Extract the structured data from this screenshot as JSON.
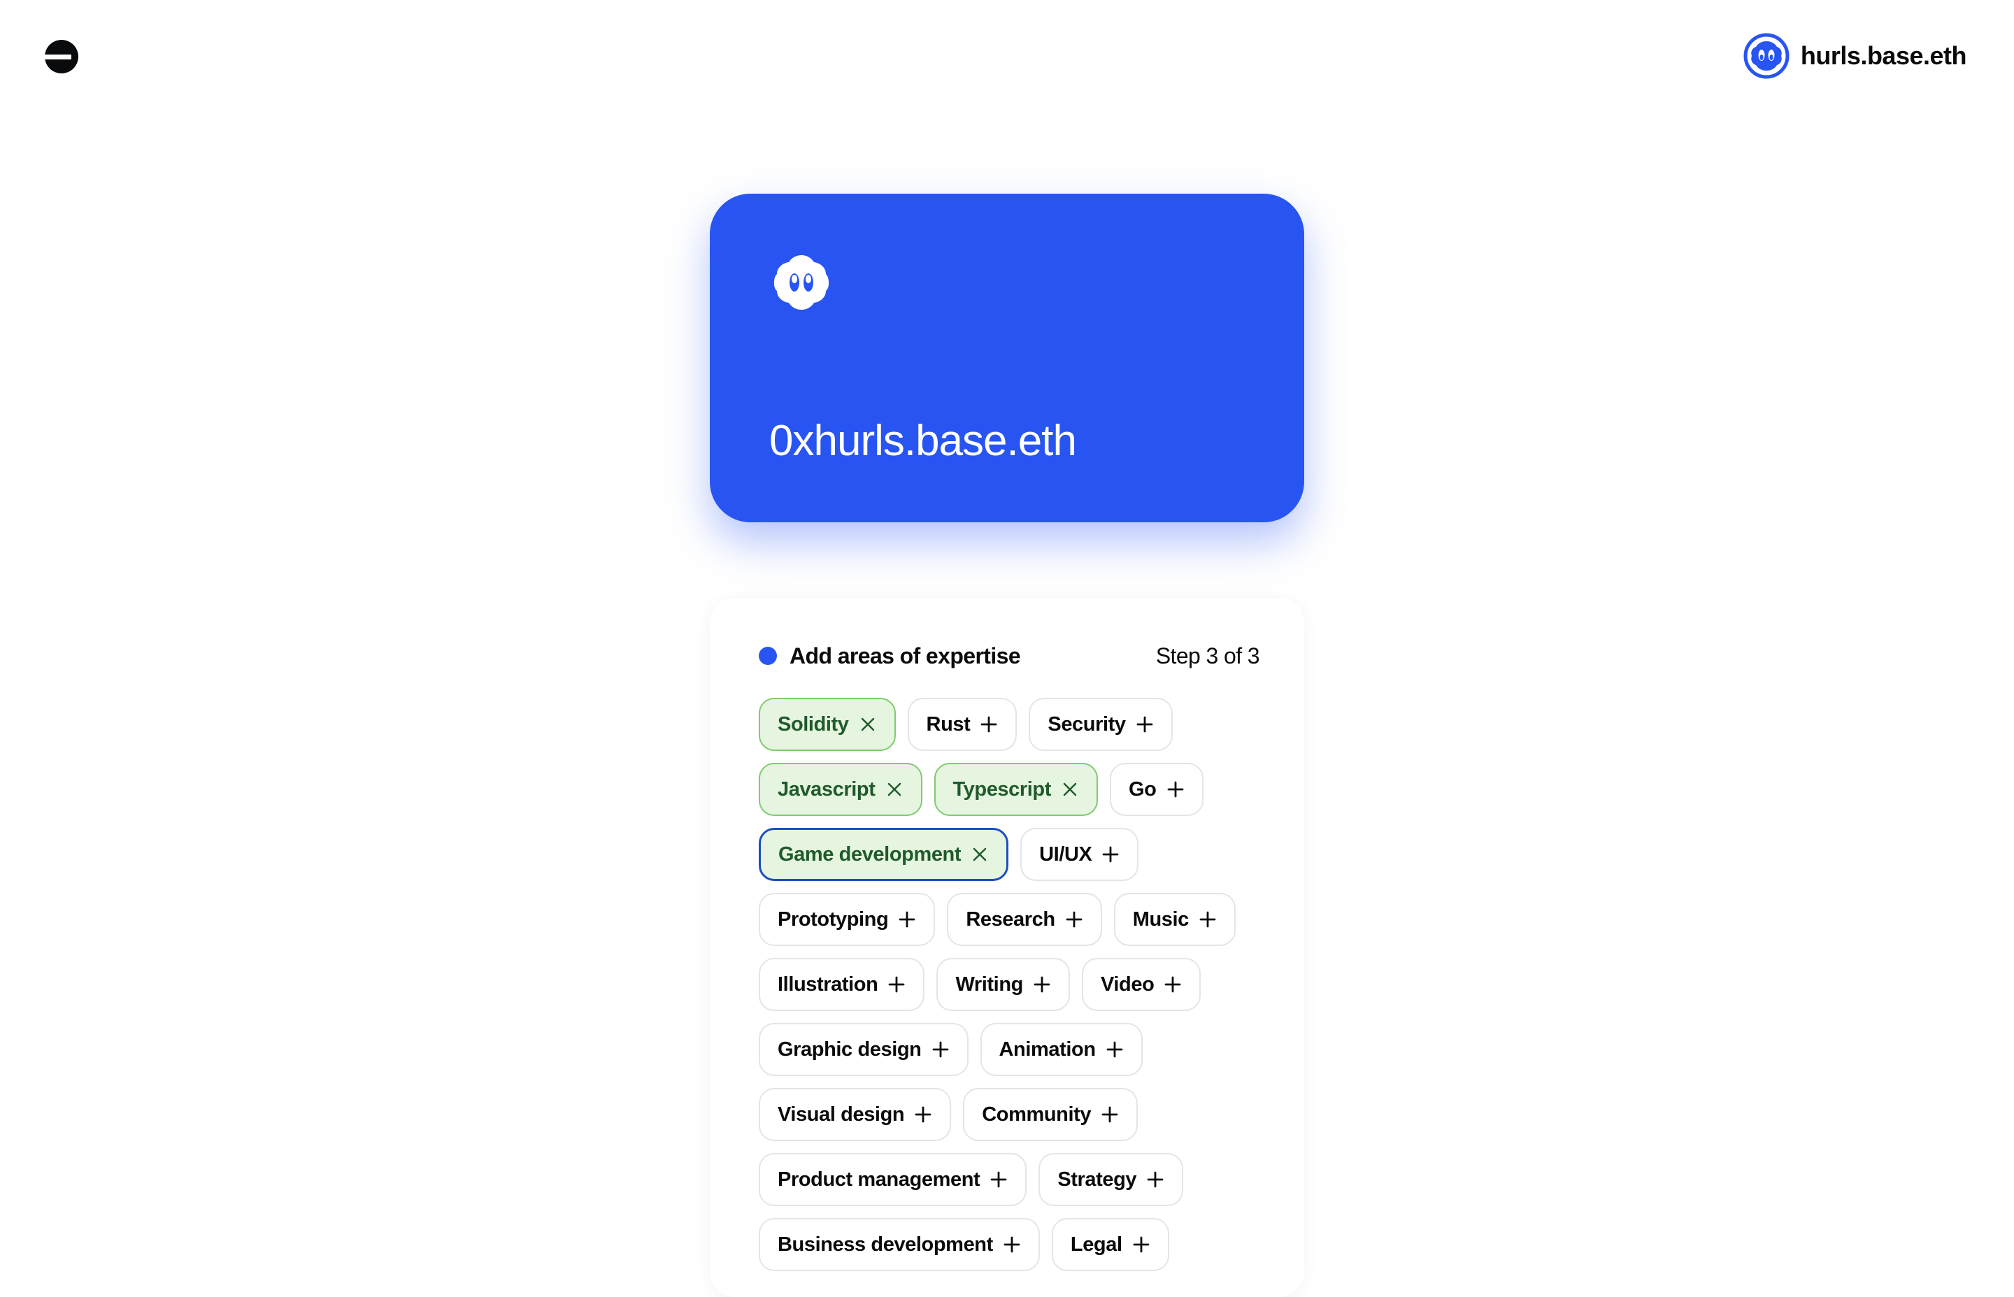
{
  "header": {
    "logo_icon": "base-logo-icon",
    "account_name": "hurls.base.eth",
    "avatar_icon": "basename-avatar-icon"
  },
  "card": {
    "name": "0xhurls.base.eth",
    "logo_icon": "basename-face-icon",
    "color": "#2855f2"
  },
  "panel": {
    "title": "Add areas of expertise",
    "step": "Step 3 of 3",
    "accent": "#2855f2"
  },
  "tags": [
    {
      "label": "Solidity",
      "selected": true
    },
    {
      "label": "Rust",
      "selected": false
    },
    {
      "label": "Security",
      "selected": false
    },
    {
      "label": "Javascript",
      "selected": true
    },
    {
      "label": "Typescript",
      "selected": true
    },
    {
      "label": "Go",
      "selected": false
    },
    {
      "label": "Game development",
      "selected": true,
      "focused": true
    },
    {
      "label": "UI/UX",
      "selected": false
    },
    {
      "label": "Prototyping",
      "selected": false
    },
    {
      "label": "Research",
      "selected": false
    },
    {
      "label": "Music",
      "selected": false
    },
    {
      "label": "Illustration",
      "selected": false
    },
    {
      "label": "Writing",
      "selected": false
    },
    {
      "label": "Video",
      "selected": false
    },
    {
      "label": "Graphic design",
      "selected": false
    },
    {
      "label": "Animation",
      "selected": false
    },
    {
      "label": "Visual design",
      "selected": false
    },
    {
      "label": "Community",
      "selected": false
    },
    {
      "label": "Product management",
      "selected": false
    },
    {
      "label": "Strategy",
      "selected": false
    },
    {
      "label": "Business development",
      "selected": false
    },
    {
      "label": "Legal",
      "selected": false
    }
  ]
}
